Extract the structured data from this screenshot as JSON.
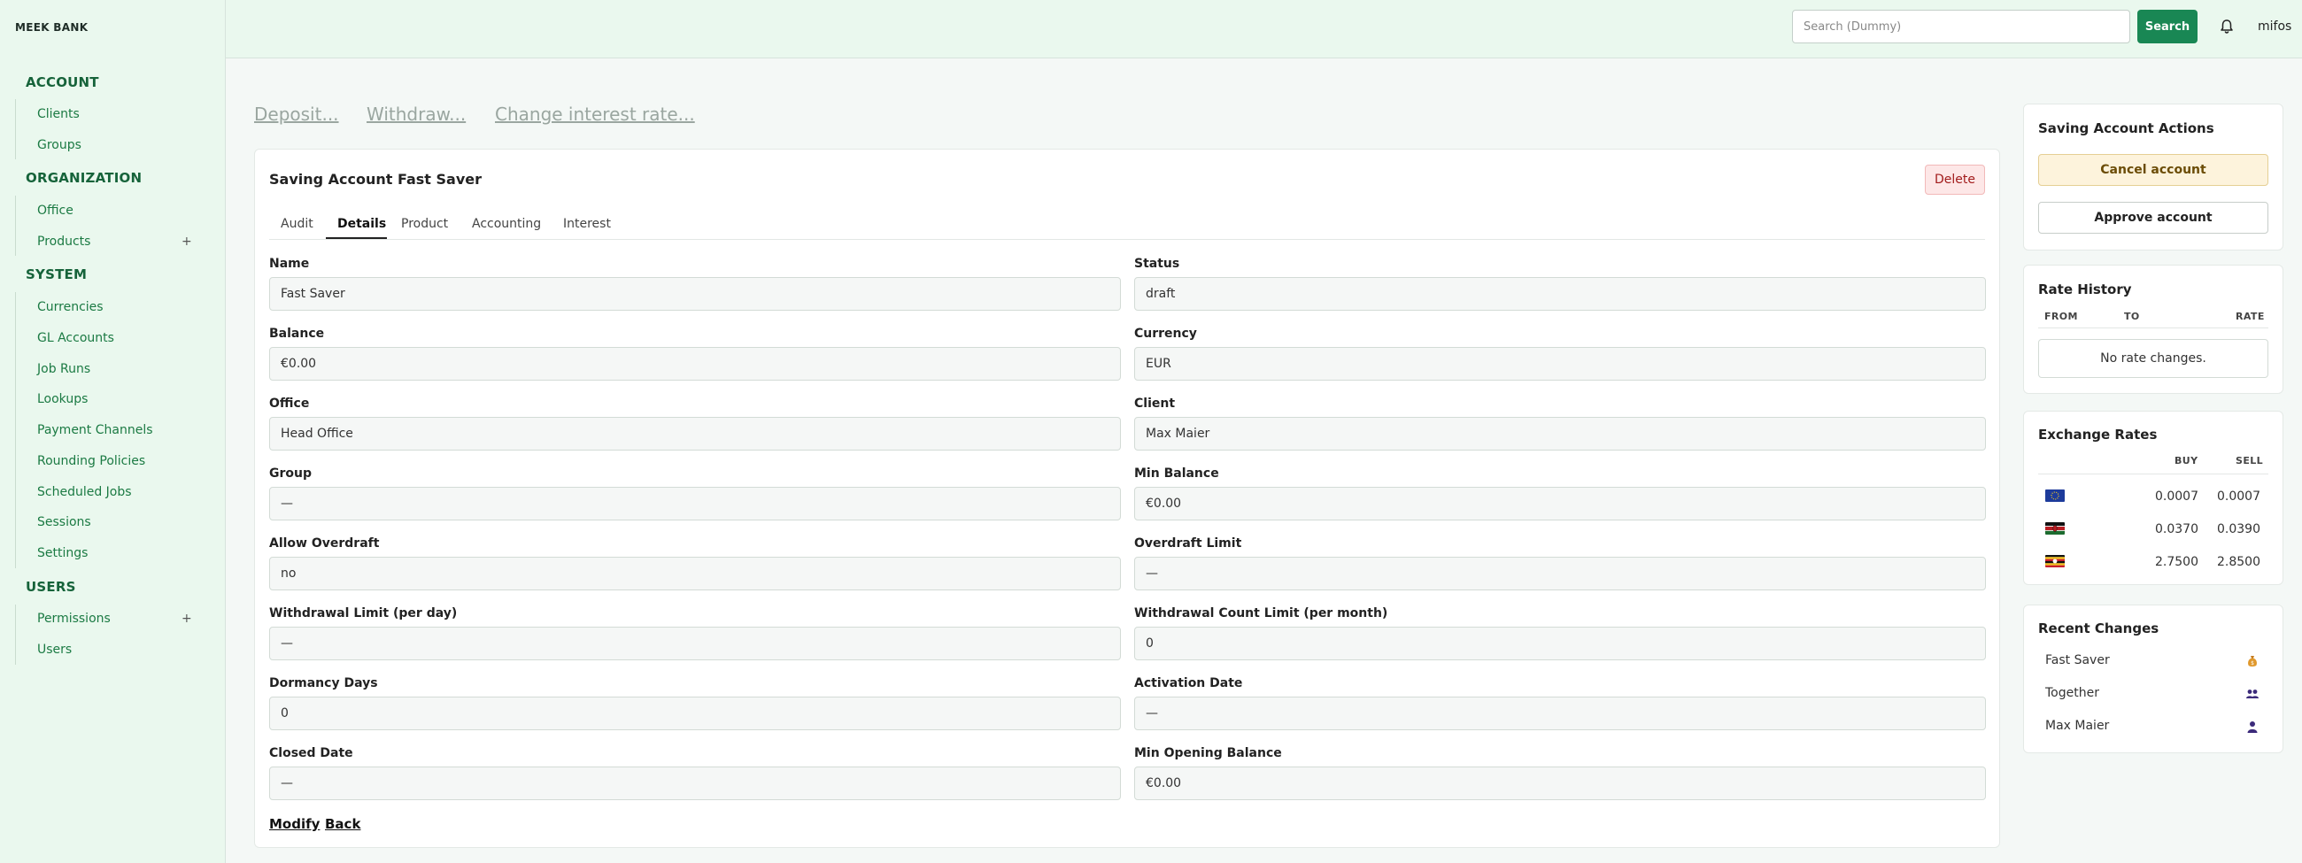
{
  "brand": "MEEK BANK",
  "sidebar": {
    "sections": [
      {
        "title": "ACCOUNT",
        "items": [
          {
            "label": "Clients"
          },
          {
            "label": "Groups"
          }
        ]
      },
      {
        "title": "ORGANIZATION",
        "items": [
          {
            "label": "Office"
          },
          {
            "label": "Products"
          }
        ]
      },
      {
        "title": "SYSTEM",
        "items": [
          {
            "label": "Currencies"
          },
          {
            "label": "GL Accounts"
          },
          {
            "label": "Job Runs"
          },
          {
            "label": "Lookups"
          },
          {
            "label": "Payment Channels"
          },
          {
            "label": "Rounding Policies"
          },
          {
            "label": "Scheduled Jobs"
          },
          {
            "label": "Sessions"
          },
          {
            "label": "Settings"
          }
        ]
      },
      {
        "title": "USERS",
        "items": [
          {
            "label": "Permissions"
          },
          {
            "label": "Users"
          }
        ]
      }
    ],
    "expand_symbol": "+"
  },
  "topbar": {
    "search_placeholder": "Search (Dummy)",
    "search_button": "Search",
    "user": "mifos"
  },
  "actions": {
    "deposit": "Deposit...",
    "withdraw": "Withdraw...",
    "change_rate": "Change interest rate..."
  },
  "account": {
    "title": "Saving Account Fast Saver",
    "delete_label": "Delete",
    "tabs": [
      "Audit",
      "Details",
      "Product",
      "Accounting",
      "Interest"
    ],
    "active_tab": "Details",
    "fields": [
      {
        "label": "Name",
        "value": "Fast Saver"
      },
      {
        "label": "Status",
        "value": "draft"
      },
      {
        "label": "Balance",
        "value": "€0.00"
      },
      {
        "label": "Currency",
        "value": "EUR"
      },
      {
        "label": "Office",
        "value": "Head Office"
      },
      {
        "label": "Client",
        "value": "Max Maier"
      },
      {
        "label": "Group",
        "value": "—"
      },
      {
        "label": "Min Balance",
        "value": "€0.00"
      },
      {
        "label": "Allow Overdraft",
        "value": "no"
      },
      {
        "label": "Overdraft Limit",
        "value": "—"
      },
      {
        "label": "Withdrawal Limit (per day)",
        "value": "—"
      },
      {
        "label": "Withdrawal Count Limit (per month)",
        "value": "0"
      },
      {
        "label": "Dormancy Days",
        "value": "0"
      },
      {
        "label": "Activation Date",
        "value": "—"
      },
      {
        "label": "Closed Date",
        "value": "—"
      },
      {
        "label": "Min Opening Balance",
        "value": "€0.00"
      }
    ],
    "modify_label": "Modify",
    "back_label": "Back"
  },
  "account_actions": {
    "title": "Saving Account Actions",
    "cancel_label": "Cancel account",
    "approve_label": "Approve account"
  },
  "rate_history": {
    "title": "Rate History",
    "headers": [
      "FROM",
      "TO",
      "RATE"
    ],
    "empty_text": "No rate changes."
  },
  "exchange_rates": {
    "title": "Exchange Rates",
    "headers": [
      "BUY",
      "SELL"
    ],
    "rows": [
      {
        "flag": "eu-flag-icon",
        "buy": "0.0007",
        "sell": "0.0007"
      },
      {
        "flag": "kenya-flag-icon",
        "buy": "0.0370",
        "sell": "0.0390"
      },
      {
        "flag": "uganda-flag-icon",
        "buy": "2.7500",
        "sell": "2.8500"
      }
    ]
  },
  "recent_changes": {
    "title": "Recent Changes",
    "items": [
      {
        "label": "Fast Saver",
        "icon": "money-bag-icon"
      },
      {
        "label": "Together",
        "icon": "group-icon"
      },
      {
        "label": "Max Maier",
        "icon": "person-icon"
      }
    ]
  },
  "colors": {
    "accent": "#198754",
    "sidebar_bg": "#eaf8ee",
    "link_green": "#1b7a43"
  }
}
